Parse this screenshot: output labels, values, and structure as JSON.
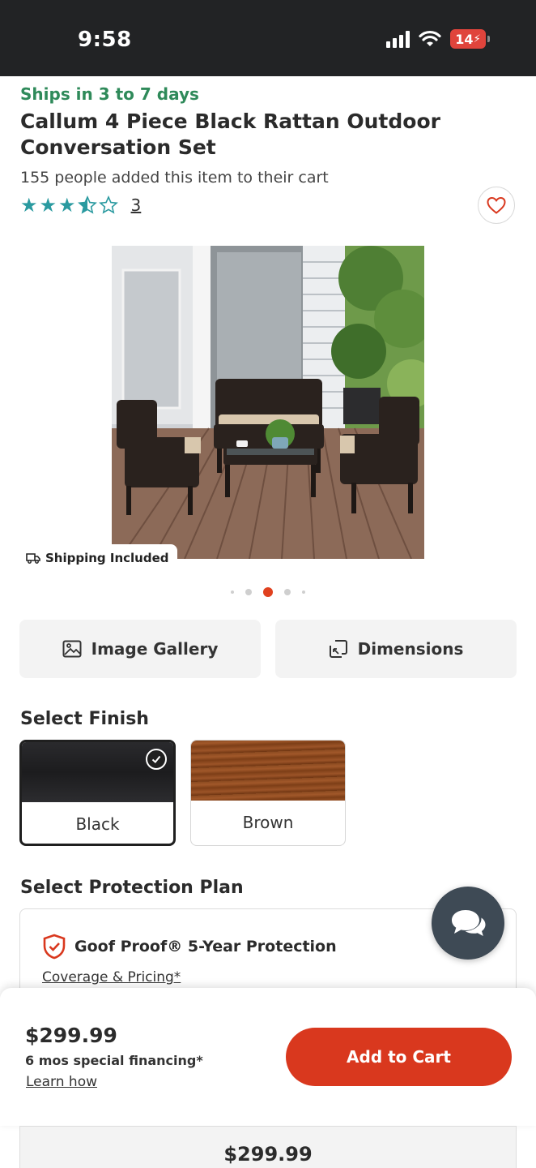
{
  "status_bar": {
    "time": "9:58",
    "battery": "14"
  },
  "product": {
    "shipping_eta": "Ships in 3 to 7 days",
    "title": "Callum 4 Piece Black Rattan Outdoor Conversation Set",
    "cart_count_text": "155 people added this item to their cart",
    "rating": 3.5,
    "rating_max": 5,
    "review_count": "3",
    "shipping_tag": "Shipping Included",
    "image_dots": {
      "total": 5,
      "active": 3
    }
  },
  "actions": {
    "gallery_label": "Image Gallery",
    "dimensions_label": "Dimensions"
  },
  "finish": {
    "title": "Select Finish",
    "options": [
      {
        "label": "Black",
        "selected": true
      },
      {
        "label": "Brown",
        "selected": false
      }
    ]
  },
  "protection": {
    "title": "Select Protection Plan",
    "plan_name": "Goof Proof® 5-Year Protection",
    "coverage_link": "Coverage & Pricing*"
  },
  "bottom_bar": {
    "price": "$299.99",
    "financing": "6 mos special financing*",
    "learn_link": "Learn how",
    "add_to_cart": "Add to Cart"
  },
  "lower_panel": {
    "price": "$299.99"
  },
  "colors": {
    "accent": "#d9381e",
    "ships_green": "#2f8a5a",
    "star_teal": "#2a9aa0",
    "chat_bg": "#3e4a55"
  }
}
